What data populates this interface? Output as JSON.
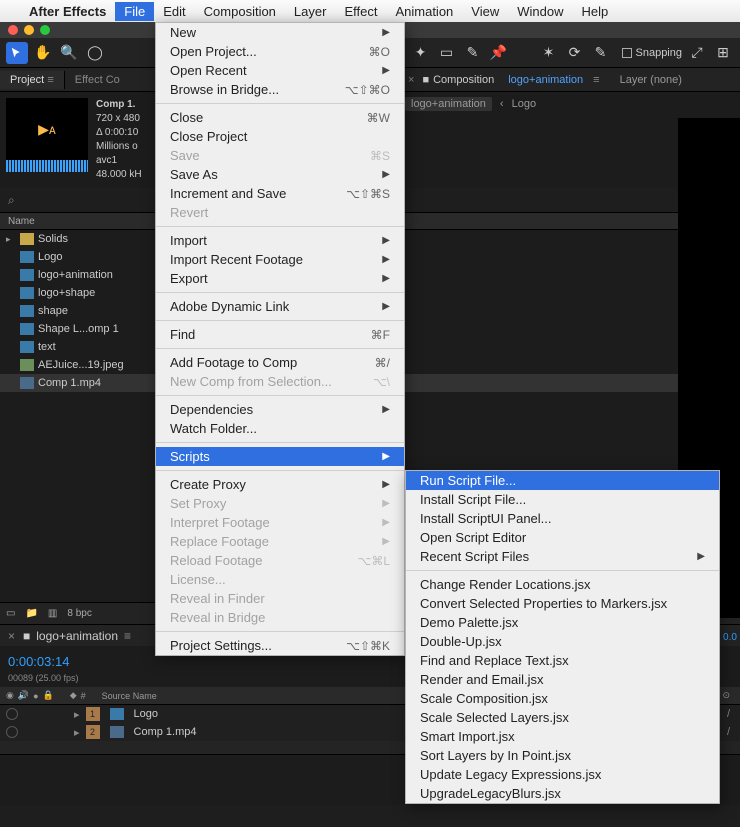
{
  "menubar": {
    "app": "After Effects",
    "items": [
      "File",
      "Edit",
      "Composition",
      "Layer",
      "Effect",
      "Animation",
      "View",
      "Window",
      "Help"
    ],
    "active": "File"
  },
  "toolbar": {
    "snapping": "Snapping"
  },
  "project_panel": {
    "title": "Project",
    "effect_tab": "Effect Co",
    "comp_name": "Comp 1.",
    "res": "720 x 480",
    "delta": "Δ 0:00:10",
    "colors": "Millions o",
    "codec": "avc1",
    "khz": "48.000 kH"
  },
  "name_header": "Name",
  "type_col": "T",
  "project_items": [
    {
      "name": "Solids",
      "type": "folder",
      "sw": "y"
    },
    {
      "name": "Logo",
      "type": "comp",
      "sw": "pk",
      "c": "C"
    },
    {
      "name": "logo+animation",
      "type": "comp",
      "sw": "bl",
      "c": "C"
    },
    {
      "name": "logo+shape",
      "type": "comp",
      "sw": "bl",
      "c": "C"
    },
    {
      "name": "shape",
      "type": "comp",
      "sw": "bl",
      "c": "C"
    },
    {
      "name": "Shape L...omp 1",
      "type": "comp",
      "sw": "bl",
      "c": "C"
    },
    {
      "name": "text",
      "type": "comp",
      "sw": "lv",
      "c": "C"
    },
    {
      "name": "AEJuice...19.jpeg",
      "type": "jpeg",
      "sw": "",
      "c": "I"
    },
    {
      "name": "Comp 1.mp4",
      "type": "mp4",
      "sw": "",
      "c": "I",
      "sel": true
    }
  ],
  "project_footer": {
    "bpc": "8 bpc"
  },
  "comp_tab": {
    "icon": "■",
    "label": "Composition",
    "name": "logo+animation",
    "layer": "Layer (none)"
  },
  "crumb": {
    "a": "logo+animation",
    "b": "Logo"
  },
  "file_menu": [
    {
      "t": "New",
      "arrow": true
    },
    {
      "t": "Open Project...",
      "sc": "⌘O"
    },
    {
      "t": "Open Recent",
      "arrow": true
    },
    {
      "t": "Browse in Bridge...",
      "sc": "⌥⇧⌘O"
    },
    {
      "sep": true
    },
    {
      "t": "Close",
      "sc": "⌘W"
    },
    {
      "t": "Close Project"
    },
    {
      "t": "Save",
      "sc": "⌘S",
      "dis": true
    },
    {
      "t": "Save As",
      "arrow": true
    },
    {
      "t": "Increment and Save",
      "sc": "⌥⇧⌘S"
    },
    {
      "t": "Revert",
      "dis": true
    },
    {
      "sep": true
    },
    {
      "t": "Import",
      "arrow": true
    },
    {
      "t": "Import Recent Footage",
      "arrow": true
    },
    {
      "t": "Export",
      "arrow": true
    },
    {
      "sep": true
    },
    {
      "t": "Adobe Dynamic Link",
      "arrow": true
    },
    {
      "sep": true
    },
    {
      "t": "Find",
      "sc": "⌘F"
    },
    {
      "sep": true
    },
    {
      "t": "Add Footage to Comp",
      "sc": "⌘/"
    },
    {
      "t": "New Comp from Selection...",
      "sc": "⌥\\",
      "dis": true
    },
    {
      "sep": true
    },
    {
      "t": "Dependencies",
      "arrow": true
    },
    {
      "t": "Watch Folder..."
    },
    {
      "sep": true
    },
    {
      "t": "Scripts",
      "arrow": true,
      "hl": true
    },
    {
      "sep": true
    },
    {
      "t": "Create Proxy",
      "arrow": true
    },
    {
      "t": "Set Proxy",
      "arrow": true,
      "dis": true
    },
    {
      "t": "Interpret Footage",
      "arrow": true,
      "dis": true
    },
    {
      "t": "Replace Footage",
      "arrow": true,
      "dis": true
    },
    {
      "t": "Reload Footage",
      "sc": "⌥⌘L",
      "dis": true
    },
    {
      "t": "License...",
      "dis": true
    },
    {
      "t": "Reveal in Finder",
      "dis": true
    },
    {
      "t": "Reveal in Bridge",
      "dis": true
    },
    {
      "sep": true
    },
    {
      "t": "Project Settings...",
      "sc": "⌥⇧⌘K"
    }
  ],
  "scripts_menu": [
    {
      "t": "Run Script File...",
      "hl": true
    },
    {
      "t": "Install Script File..."
    },
    {
      "t": "Install ScriptUI Panel..."
    },
    {
      "t": "Open Script Editor"
    },
    {
      "t": "Recent Script Files",
      "arrow": true
    },
    {
      "sep": true
    },
    {
      "t": "Change Render Locations.jsx"
    },
    {
      "t": "Convert Selected Properties to Markers.jsx"
    },
    {
      "t": "Demo Palette.jsx"
    },
    {
      "t": "Double-Up.jsx"
    },
    {
      "t": "Find and Replace Text.jsx"
    },
    {
      "t": "Render and Email.jsx"
    },
    {
      "t": "Scale Composition.jsx"
    },
    {
      "t": "Scale Selected Layers.jsx"
    },
    {
      "t": "Smart Import.jsx"
    },
    {
      "t": "Sort Layers by In Point.jsx"
    },
    {
      "t": "Update Legacy Expressions.jsx"
    },
    {
      "t": "UpgradeLegacyBlurs.jsx"
    }
  ],
  "timeline": {
    "tab": "logo+animation",
    "time": "0:00:03:14",
    "sub": "00089 (25.00 fps)",
    "col": "Source Name",
    "rows": [
      {
        "n": "1",
        "name": "Logo",
        "type": "comp"
      },
      {
        "n": "2",
        "name": "Comp 1.mp4",
        "type": "mp4"
      }
    ],
    "edge": "0.0"
  }
}
